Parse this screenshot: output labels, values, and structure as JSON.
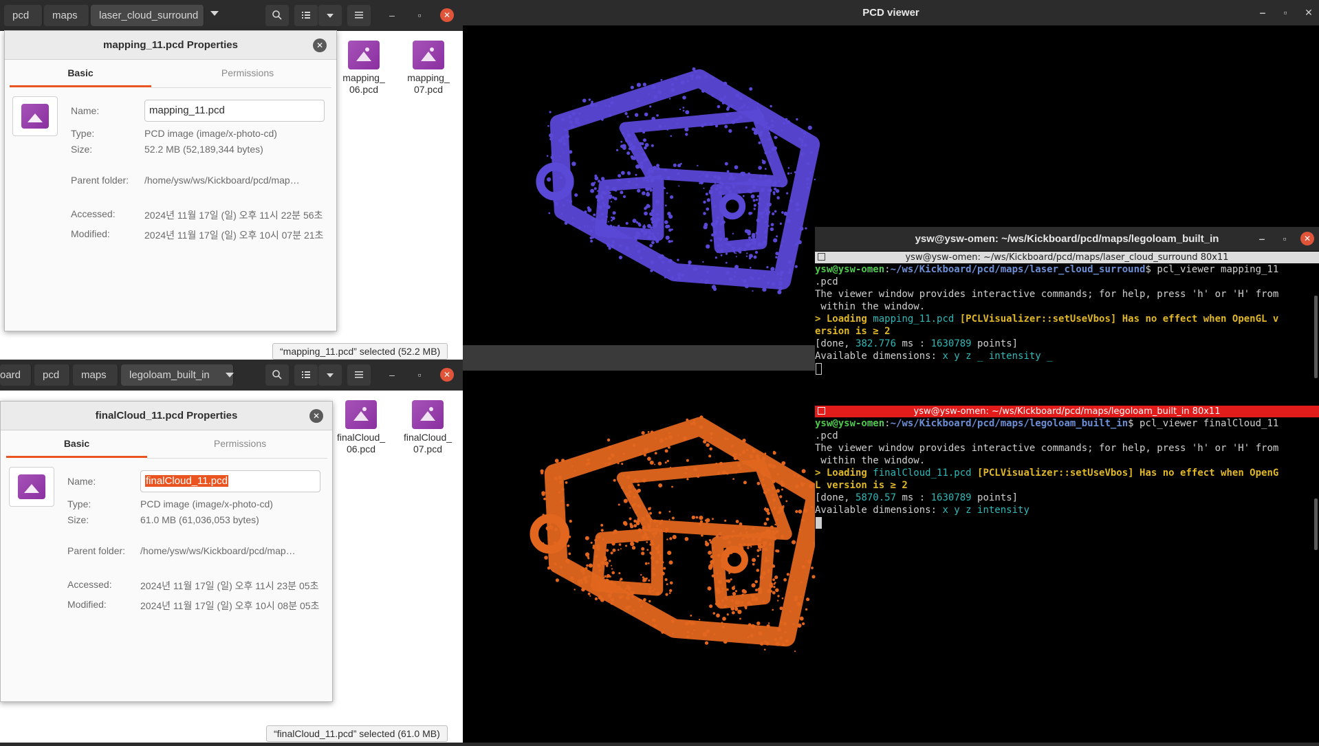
{
  "top_fm": {
    "breadcrumbs": [
      "pcd",
      "maps",
      "laser_cloud_surround"
    ],
    "files": [
      {
        "label": "mapping_\n06.pcd"
      },
      {
        "label": "mapping_\n07.pcd"
      }
    ],
    "status": "“mapping_11.pcd” selected  (52.2 MB)"
  },
  "top_props": {
    "title": "mapping_11.pcd Properties",
    "tabs": [
      "Basic",
      "Permissions"
    ],
    "labels": {
      "name": "Name:",
      "type": "Type:",
      "size": "Size:",
      "parent": "Parent folder:",
      "accessed": "Accessed:",
      "modified": "Modified:"
    },
    "name": "mapping_11.pcd",
    "type": "PCD image (image/x-photo-cd)",
    "size": "52.2 MB (52,189,344 bytes)",
    "parent": "/home/ysw/ws/Kickboard/pcd/map…",
    "accessed": "2024년 11월 17일 (일) 오후 11시 22분 56초",
    "modified": "2024년 11월 17일 (일) 오후 10시 07분 21초"
  },
  "bottom_fm": {
    "breadcrumbs": [
      "oard",
      "pcd",
      "maps",
      "legoloam_built_in"
    ],
    "files": [
      {
        "label": "finalCloud_\n06.pcd"
      },
      {
        "label": "finalCloud_\n07.pcd"
      }
    ],
    "status": "“finalCloud_11.pcd” selected  (61.0 MB)"
  },
  "bottom_props": {
    "title": "finalCloud_11.pcd Properties",
    "tabs": [
      "Basic",
      "Permissions"
    ],
    "labels": {
      "name": "Name:",
      "type": "Type:",
      "size": "Size:",
      "parent": "Parent folder:",
      "accessed": "Accessed:",
      "modified": "Modified:"
    },
    "name": "finalCloud_11.pcd",
    "type": "PCD image (image/x-photo-cd)",
    "size": "61.0 MB (61,036,053 bytes)",
    "parent": "/home/ysw/ws/Kickboard/pcd/map…",
    "accessed": "2024년 11월 17일 (일) 오후 11시 23분 05초",
    "modified": "2024년 11월 17일 (일) 오후 10시 08분 05초"
  },
  "pcd_viewer": {
    "title": "PCD viewer",
    "colors": {
      "top_cloud": "#5a48d6",
      "bottom_cloud": "#e2661e"
    }
  },
  "terminal": {
    "title": "ysw@ysw-omen: ~/ws/Kickboard/pcd/maps/legoloam_built_in",
    "pane1": {
      "title": "ysw@ysw-omen: ~/ws/Kickboard/pcd/maps/laser_cloud_surround 80x11",
      "prompt_user": "ysw@ysw-omen",
      "prompt_path": "~/ws/Kickboard/pcd/maps/laser_cloud_surround",
      "command": "$ pcl_viewer mapping_11",
      "command_wrap": ".pcd",
      "line1": "The viewer window provides interactive commands; for help, press 'h' or 'H' from",
      "line2": " within the window.",
      "load_prefix": "> Loading ",
      "load_file": "mapping_11.pcd",
      "load_warn": " [PCLVisualizer::setUseVbos] Has no effect when OpenGL v",
      "load_warn2": "ersion is ≥ 2",
      "done_prefix": "[done, ",
      "done_ms": "382.776",
      "done_mid": " ms : ",
      "done_points": "1630789",
      "done_suffix": " points]",
      "dims_prefix": "Available dimensions: ",
      "dims": "x y z _ intensity _"
    },
    "pane2": {
      "title": "ysw@ysw-omen: ~/ws/Kickboard/pcd/maps/legoloam_built_in 80x11",
      "prompt_user": "ysw@ysw-omen",
      "prompt_path": "~/ws/Kickboard/pcd/maps/legoloam_built_in",
      "command": "$ pcl_viewer finalCloud_11",
      "command_wrap": ".pcd",
      "line1": "The viewer window provides interactive commands; for help, press 'h' or 'H' from",
      "line2": " within the window.",
      "load_prefix": "> Loading ",
      "load_file": "finalCloud_11.pcd",
      "load_warn": " [PCLVisualizer::setUseVbos] Has no effect when OpenG",
      "load_warn2": "L version is ≥ 2",
      "done_prefix": "[done, ",
      "done_ms": "5870.57",
      "done_mid": " ms : ",
      "done_points": "1630789",
      "done_suffix": " points]",
      "dims_prefix": "Available dimensions: ",
      "dims": "x y z intensity"
    }
  }
}
